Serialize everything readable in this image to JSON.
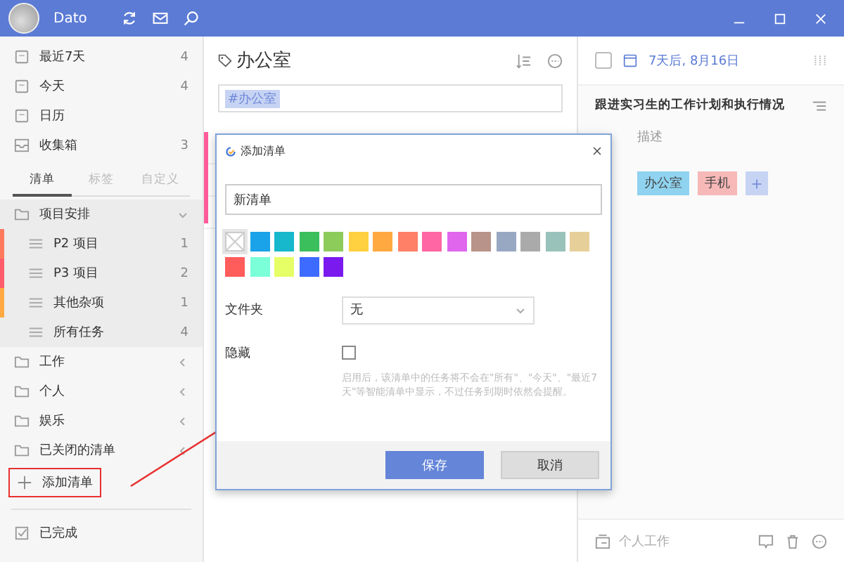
{
  "topbar": {
    "user": "Dato"
  },
  "smart_lists": [
    {
      "label": "最近7天",
      "count": "4",
      "kind": "calendar"
    },
    {
      "label": "今天",
      "count": "4",
      "kind": "calendar"
    },
    {
      "label": "日历",
      "kind": "calendar"
    },
    {
      "label": "收集箱",
      "count": "3",
      "kind": "inbox"
    }
  ],
  "sidebar_tabs": [
    {
      "label": "清单",
      "selected": true
    },
    {
      "label": "标签",
      "selected": false
    },
    {
      "label": "自定义",
      "selected": false
    }
  ],
  "folders": [
    {
      "label": "项目安排",
      "expanded": true,
      "children": [
        {
          "label": "P2 项目",
          "count": "1",
          "color": "#ff7a5c"
        },
        {
          "label": "P3 项目",
          "count": "2",
          "color": "#ff5c6b"
        },
        {
          "label": "其他杂项",
          "count": "1",
          "color": "#ffa940"
        },
        {
          "label": "所有任务",
          "count": "4"
        }
      ]
    },
    {
      "label": "工作",
      "expanded": false
    },
    {
      "label": "个人",
      "expanded": false
    },
    {
      "label": "娱乐",
      "expanded": false
    },
    {
      "label": "已关闭的清单",
      "expanded": false
    }
  ],
  "add_list": "添加清单",
  "completed": "已完成",
  "middle": {
    "title": "办公室",
    "filter": "#办公室"
  },
  "detail": {
    "checked": false,
    "date": "7天后, 8月16日",
    "task_title": "跟进实习生的工作计划和执行情况",
    "description_placeholder": "描述",
    "tags": [
      {
        "label": "办公室",
        "color": "#8fd3f0"
      },
      {
        "label": "手机",
        "color": "#f7b8b8"
      }
    ],
    "list_name": "个人工作"
  },
  "dialog": {
    "title": "添加清单",
    "name_value": "新清单",
    "colors": [
      {
        "kind": "none",
        "selected": true
      },
      {
        "color": "#1aa3e8",
        "selected": false
      },
      {
        "color": "#17b8cc",
        "selected": false
      },
      {
        "color": "#3bbf5c",
        "selected": false
      },
      {
        "color": "#8dcb5a",
        "selected": false
      },
      {
        "color": "#ffd040",
        "selected": false
      },
      {
        "color": "#ffa940",
        "selected": false
      },
      {
        "color": "#ff8066",
        "selected": false
      },
      {
        "color": "#ff66a3",
        "selected": false
      },
      {
        "color": "#e066ee",
        "selected": false
      },
      {
        "color": "#b8938a",
        "selected": false
      },
      {
        "color": "#99a8c2",
        "selected": false
      },
      {
        "color": "#aaaaaa",
        "selected": false
      },
      {
        "color": "#99c2bb",
        "selected": false
      },
      {
        "color": "#e6cf99",
        "selected": false
      },
      {
        "color": "#ff5c5c",
        "selected": false
      },
      {
        "color": "#7affd9",
        "selected": false
      },
      {
        "color": "#e6ff66",
        "selected": false
      },
      {
        "color": "#3d6bff",
        "selected": false
      },
      {
        "color": "#7a1aee",
        "selected": false
      }
    ],
    "folder_label": "文件夹",
    "folder_value": "无",
    "hide_label": "隐藏",
    "hide_checked": false,
    "hint": "启用后，该清单中的任务将不会在\"所有\"、\"今天\"、\"最近7天\"等智能清单中显示，不过任务到期时依然会提醒。",
    "save": "保存",
    "cancel": "取消"
  }
}
